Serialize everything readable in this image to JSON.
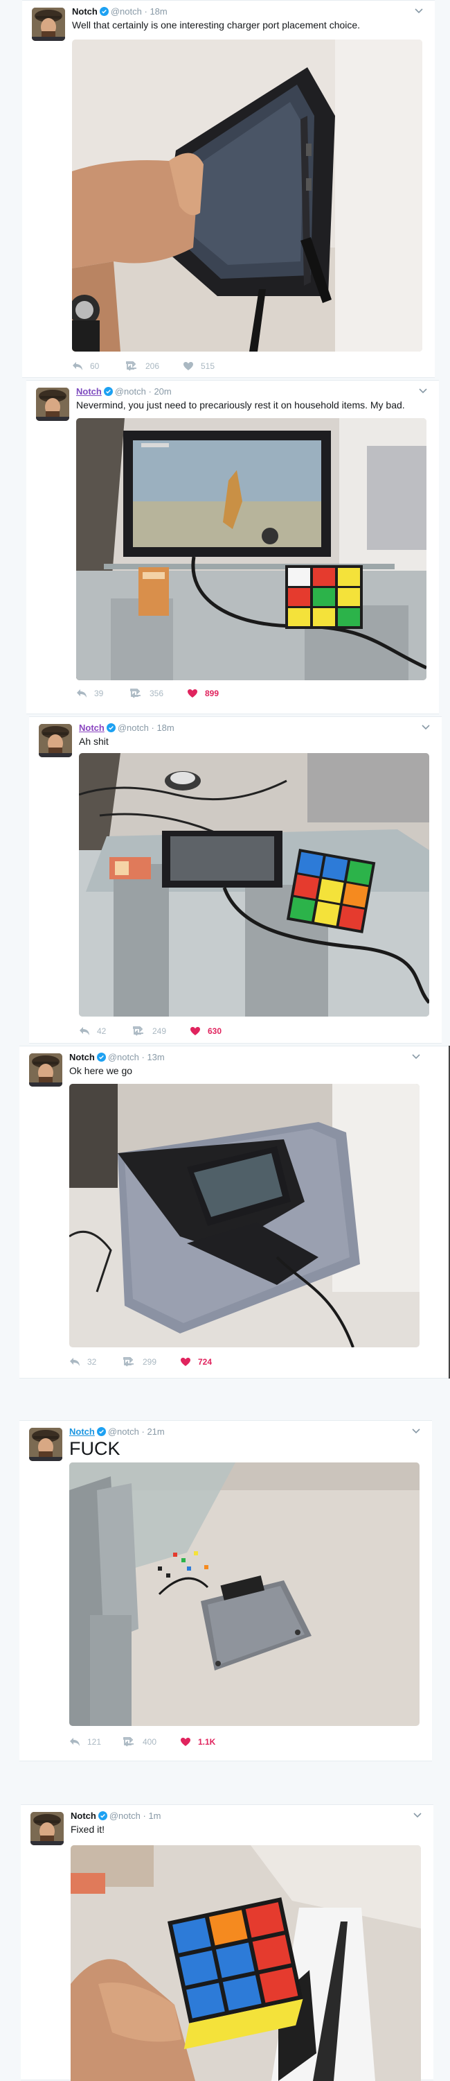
{
  "tweets": [
    {
      "name": "Notch",
      "handle": "@notch",
      "time": "18m",
      "text": "Well that certainly is one interesting charger port placement choice.",
      "replies": "60",
      "retweets": "206",
      "likes": "515",
      "liked": false
    },
    {
      "name": "Notch",
      "handle": "@notch",
      "time": "20m",
      "text": "Nevermind, you just need to precariously rest it on household items. My bad.",
      "replies": "39",
      "retweets": "356",
      "likes": "899",
      "liked": true
    },
    {
      "name": "Notch",
      "handle": "@notch",
      "time": "18m",
      "text": "Ah shit",
      "replies": "42",
      "retweets": "249",
      "likes": "630",
      "liked": true
    },
    {
      "name": "Notch",
      "handle": "@notch",
      "time": "13m",
      "text": "Ok here we go",
      "replies": "32",
      "retweets": "299",
      "likes": "724",
      "liked": true
    },
    {
      "name": "Notch",
      "handle": "@notch",
      "time": "21m",
      "text": "FUCK",
      "replies": "121",
      "retweets": "400",
      "likes": "1.1K",
      "liked": true
    },
    {
      "name": "Notch",
      "handle": "@notch",
      "time": "1m",
      "text": "Fixed it!",
      "replies": "",
      "retweets": "",
      "likes": "",
      "liked": false
    }
  ],
  "separator": "·",
  "colors": {
    "verified": "#1da1f2",
    "like_active": "#e0245e",
    "meta": "#8899a6",
    "action": "#aab8c2"
  },
  "icons": [
    "reply-icon",
    "retweet-icon",
    "heart-icon",
    "verified-icon",
    "chevron-down-icon"
  ]
}
